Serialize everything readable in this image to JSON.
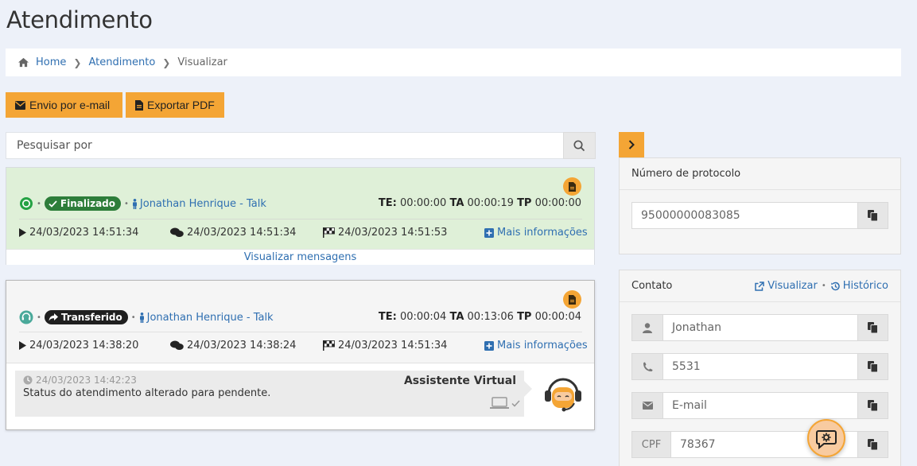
{
  "page": {
    "title": "Atendimento"
  },
  "breadcrumb": {
    "home": "Home",
    "section": "Atendimento",
    "current": "Visualizar"
  },
  "toolbar": {
    "email_label": "Envio por e-mail",
    "pdf_label": "Exportar PDF"
  },
  "search": {
    "placeholder": "Pesquisar por"
  },
  "colors": {
    "accent": "#f4a535",
    "link": "#2f6fb1",
    "finalizado": "#2d7d3a",
    "transferido": "#1f1f1f",
    "card_success_bg": "#dff0d8"
  },
  "cards": [
    {
      "channel_icon": "whatsapp-icon",
      "status": "Finalizado",
      "agent": "Jonathan Henrique - Talk",
      "te_label": "TE:",
      "te": "00:00:00",
      "ta_label": "TA",
      "ta": "00:00:19",
      "tp_label": "TP",
      "tp": "00:00:00",
      "start": "24/03/2023 14:51:34",
      "first_msg": "24/03/2023 14:51:34",
      "end": "24/03/2023 14:51:53",
      "more_label": "Mais informações",
      "view_messages": "Visualizar mensagens"
    },
    {
      "channel_icon": "headset-icon",
      "status": "Transferido",
      "agent": "Jonathan Henrique - Talk",
      "te_label": "TE:",
      "te": "00:00:04",
      "ta_label": "TA",
      "ta": "00:13:06",
      "tp_label": "TP",
      "tp": "00:00:04",
      "start": "24/03/2023 14:38:20",
      "first_msg": "24/03/2023 14:38:24",
      "end": "24/03/2023 14:51:34",
      "more_label": "Mais informações",
      "message": {
        "time": "24/03/2023 14:42:23",
        "text": "Status do atendimento alterado para pendente.",
        "author": "Assistente Virtual"
      }
    }
  ],
  "protocol": {
    "title": "Número de protocolo",
    "value": "95000000083085"
  },
  "contact": {
    "title": "Contato",
    "view_label": "Visualizar",
    "history_label": "Histórico",
    "name": "Jonathan",
    "phone": "5531",
    "email_placeholder": "E-mail",
    "cpf_label": "CPF",
    "cpf": "78367"
  }
}
